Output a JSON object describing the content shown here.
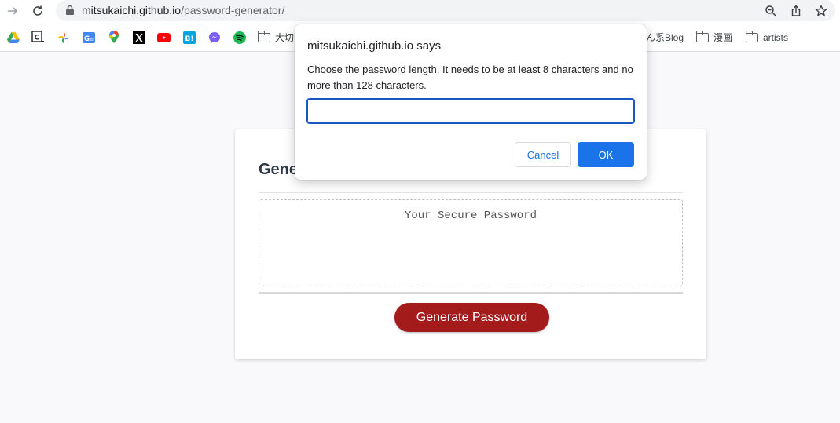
{
  "browser": {
    "url_host": "mitsukaichi.github.io",
    "url_path": "/password-generator/"
  },
  "bookmarks": {
    "icons": [
      "google-drive-icon",
      "compass-c-icon",
      "google-photos-icon",
      "google-translate-icon",
      "google-maps-icon",
      "x-icon",
      "youtube-icon",
      "hatena-bookmark-icon",
      "messenger-icon",
      "spotify-icon"
    ],
    "folders": [
      {
        "label": "大切"
      },
      {
        "label": "ん系Blog"
      },
      {
        "label": "漫画"
      },
      {
        "label": "artists"
      }
    ],
    "colors": {
      "youtube": "#ff0000",
      "spotify": "#1db954",
      "hatena": "#00a4de",
      "messenger": "#7a5cf7"
    }
  },
  "page": {
    "title": "Generate a Password",
    "password_placeholder": "Your Secure Password",
    "generate_label": "Generate Password",
    "accent": "#a31b1b"
  },
  "dialog": {
    "title": "mitsukaichi.github.io says",
    "message": "Choose the password length. It needs to be at least 8 characters and no more than 128 characters.",
    "input_value": "",
    "cancel_label": "Cancel",
    "ok_label": "OK",
    "accent": "#1a73e8"
  }
}
